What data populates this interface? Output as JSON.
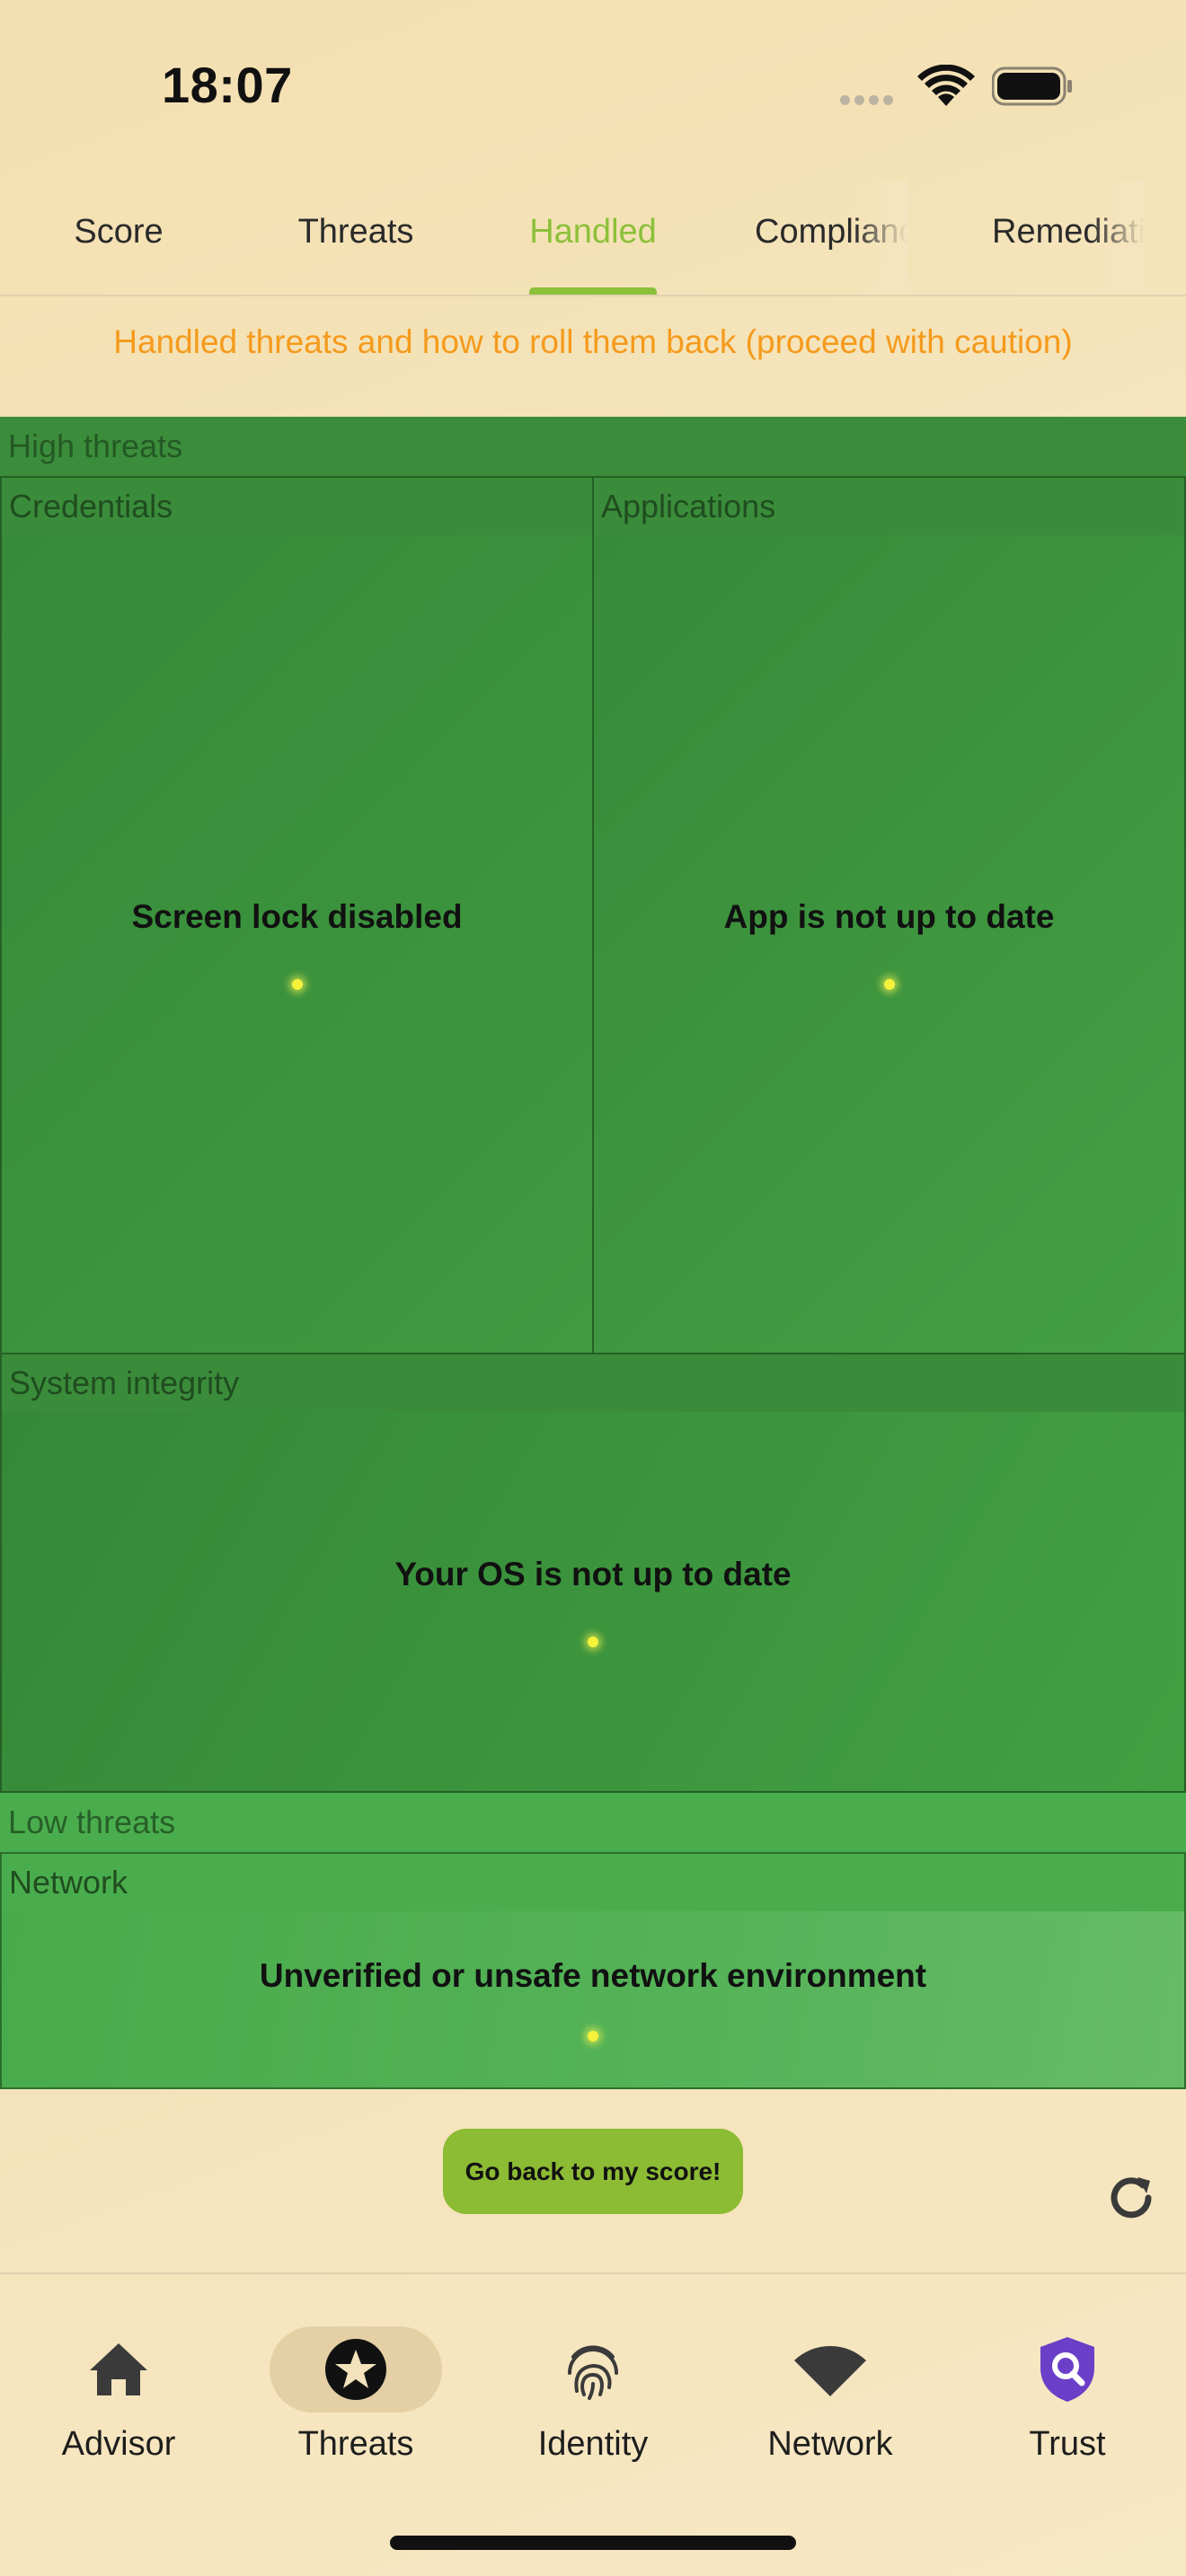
{
  "status_bar": {
    "time": "18:07"
  },
  "tabs": [
    {
      "label": "Score",
      "active": false
    },
    {
      "label": "Threats",
      "active": false
    },
    {
      "label": "Handled",
      "active": true
    },
    {
      "label": "Compliance",
      "active": false
    },
    {
      "label": "Remediation",
      "active": false
    }
  ],
  "header": {
    "subtitle": "Handled threats and how to roll them back (proceed with caution)"
  },
  "treemap": {
    "high": {
      "label": "High threats",
      "categories": [
        {
          "label": "Credentials",
          "threat": "Screen lock disabled"
        },
        {
          "label": "Applications",
          "threat": "App is not up to date"
        },
        {
          "label": "System integrity",
          "threat": "Your OS is not up to date"
        }
      ]
    },
    "low": {
      "label": "Low threats",
      "categories": [
        {
          "label": "Network",
          "threat": "Unverified or unsafe network environment"
        }
      ]
    }
  },
  "actions": {
    "back_label": "Go back to my score!"
  },
  "nav": [
    {
      "label": "Advisor",
      "icon": "home-icon",
      "active": false
    },
    {
      "label": "Threats",
      "icon": "star-icon",
      "active": true
    },
    {
      "label": "Identity",
      "icon": "fingerprint-icon",
      "active": false
    },
    {
      "label": "Network",
      "icon": "wifi-icon",
      "active": false
    },
    {
      "label": "Trust",
      "icon": "shield-search-icon",
      "active": false
    }
  ],
  "colors": {
    "accent": "#8cc03a",
    "caution": "#f59a1c",
    "high_threat": "#3a8f3c",
    "low_threat": "#4cae4f",
    "trust_icon": "#6b3fc8"
  }
}
